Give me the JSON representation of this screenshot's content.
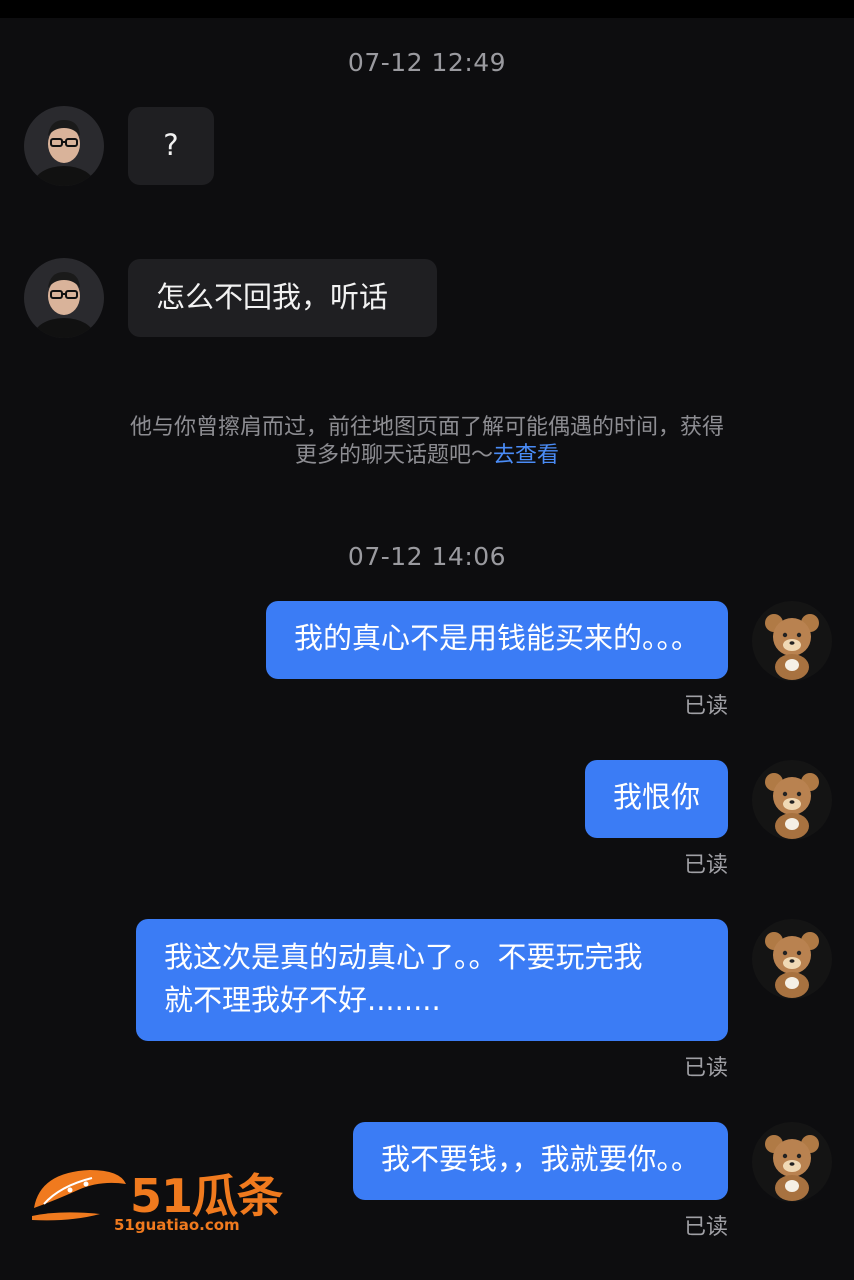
{
  "timestamps": [
    "07-12 12:49",
    "07-12 14:06"
  ],
  "incoming": [
    {
      "text": "?"
    },
    {
      "text": "怎么不回我，听话"
    }
  ],
  "system_notice": {
    "line1": "他与你曾擦肩而过，前往地图页面了解可能偶遇的时间，获得",
    "line2_prefix": "更多的聊天话题吧～",
    "link": "去查看"
  },
  "outgoing": [
    {
      "lines": [
        "我的真心不是用钱能买来的。。。"
      ],
      "status": "已读"
    },
    {
      "lines": [
        "我恨你"
      ],
      "status": "已读"
    },
    {
      "lines": [
        "我这次是真的动真心了。。不要玩完我",
        "就不理我好不好........"
      ],
      "status": "已读"
    },
    {
      "lines": [
        "我不要钱，，我就要你。。"
      ],
      "status": "已读"
    }
  ],
  "watermark": {
    "brand": "51瓜条",
    "url": "51guatiao.com"
  },
  "colors": {
    "background": "#0d0d0f",
    "outgoing_bubble": "#3b7cf5",
    "incoming_bubble": "#1f1f22",
    "link": "#4a8cf7",
    "watermark": "#f07a1e"
  },
  "icons": {
    "contact_avatar": "man-with-glasses-avatar",
    "self_avatar": "teddy-bear-avatar"
  }
}
